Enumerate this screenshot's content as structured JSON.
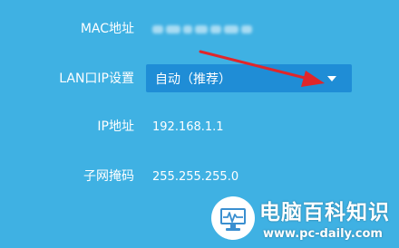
{
  "rows": {
    "mac": {
      "label": "MAC地址"
    },
    "lan_ip_setting": {
      "label": "LAN口IP设置",
      "selected": "自动（推荐）"
    },
    "ip": {
      "label": "IP地址",
      "value": "192.168.1.1"
    },
    "mask": {
      "label": "子网掩码",
      "value": "255.255.255.0"
    }
  },
  "watermark": {
    "title": "电脑百科知识",
    "url": "www.pc-daily.com"
  },
  "colors": {
    "background": "#3fb1e3",
    "select_background": "#1f8dd6",
    "arrow": "#e0262a"
  }
}
